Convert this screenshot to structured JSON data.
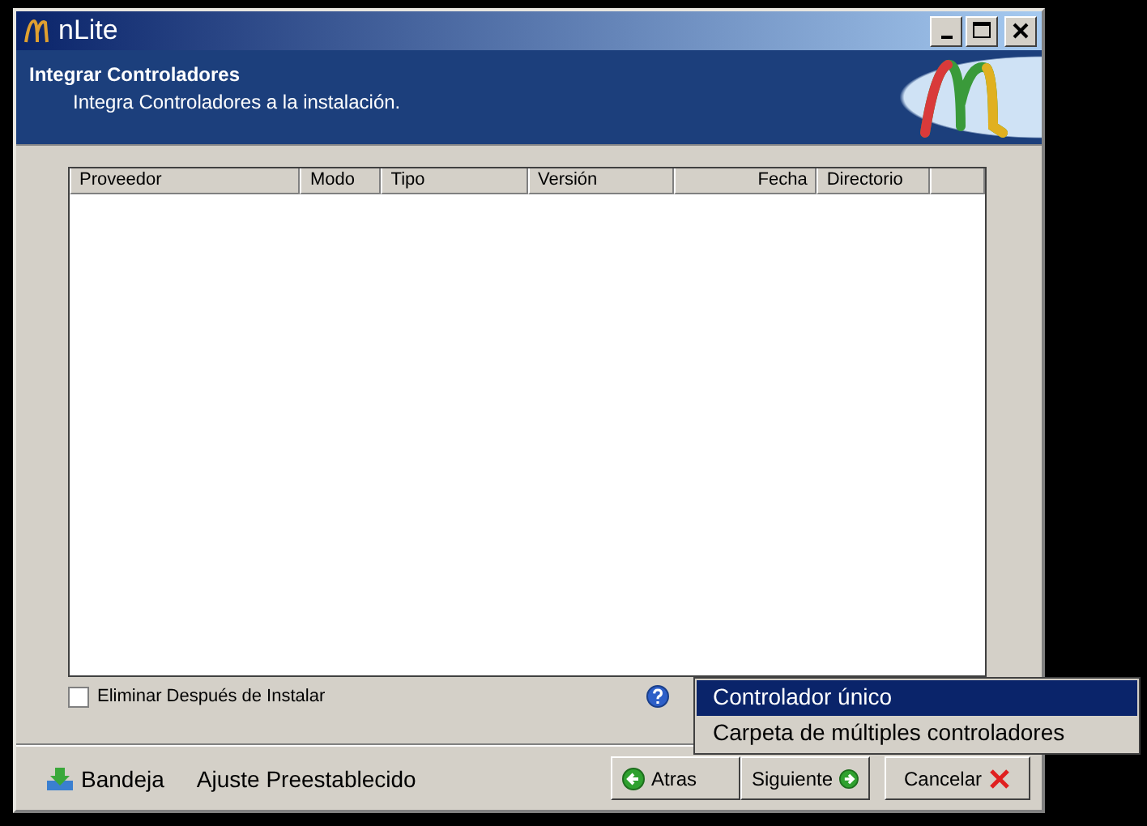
{
  "window": {
    "title": "nLite"
  },
  "header": {
    "title": "Integrar Controladores",
    "subtitle": "Integra Controladores a la instalación."
  },
  "table": {
    "columns": [
      "Proveedor",
      "Modo",
      "Tipo",
      "Versión",
      "Fecha",
      "Directorio"
    ]
  },
  "delete_after_install": {
    "label": "Eliminar Después de Instalar",
    "checked": false
  },
  "footer_links": [
    {
      "label": "Bandeja",
      "kind": "icon"
    },
    {
      "label": "Ajuste Preestablecido",
      "kind": "plain"
    }
  ],
  "buttons": [
    {
      "label": "Atras",
      "kind": "back"
    },
    {
      "label": "Siguiente",
      "kind": "next"
    },
    {
      "label": "Cancelar",
      "kind": "cancel"
    }
  ],
  "popup_menu": [
    {
      "label": "Controlador único",
      "selected": true
    },
    {
      "label": "Carpeta de múltiples controladores",
      "selected": false
    }
  ]
}
